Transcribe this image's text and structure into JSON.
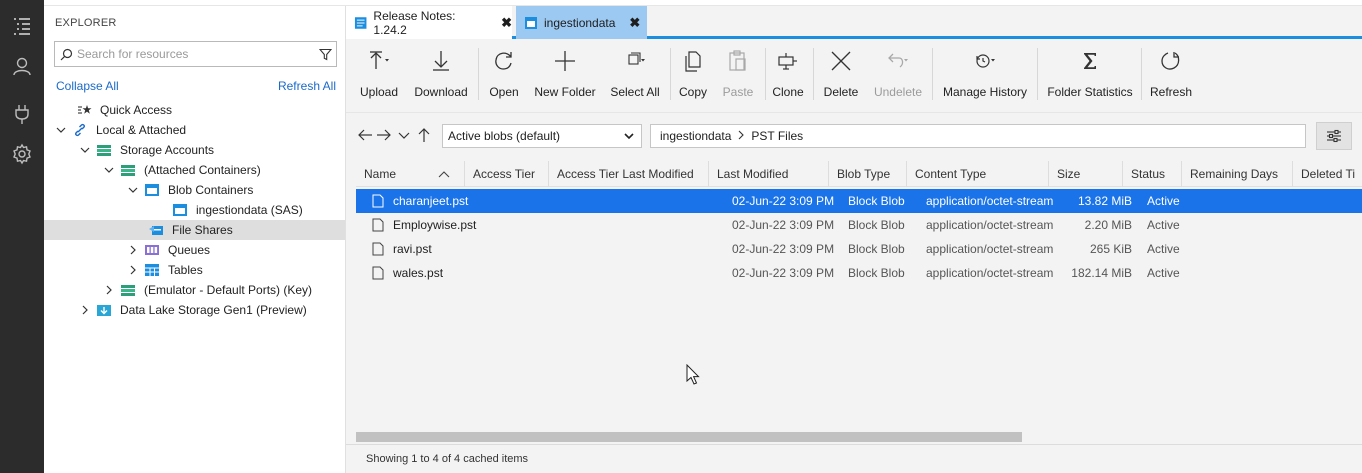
{
  "tabs": [
    {
      "label": "Release Notes: 1.24.2",
      "close": "✖"
    },
    {
      "label": "ingestiondata",
      "close": "✖"
    }
  ],
  "explorer": {
    "title": "EXPLORER",
    "search_placeholder": "Search for resources",
    "collapse_all": "Collapse All",
    "refresh_all": "Refresh All",
    "tree": [
      {
        "label": "Quick Access"
      },
      {
        "label": "Local & Attached"
      },
      {
        "label": "Storage Accounts"
      },
      {
        "label": "(Attached Containers)"
      },
      {
        "label": "Blob Containers"
      },
      {
        "label": "ingestiondata (SAS)"
      },
      {
        "label": "File Shares"
      },
      {
        "label": "Queues"
      },
      {
        "label": "Tables"
      },
      {
        "label": "(Emulator - Default Ports) (Key)"
      },
      {
        "label": "Data Lake Storage Gen1 (Preview)"
      }
    ]
  },
  "toolbar": {
    "upload": "Upload",
    "download": "Download",
    "open": "Open",
    "new_folder": "New Folder",
    "select_all": "Select All",
    "copy": "Copy",
    "paste": "Paste",
    "clone": "Clone",
    "delete": "Delete",
    "undelete": "Undelete",
    "manage_history": "Manage History",
    "folder_statistics": "Folder Statistics",
    "refresh": "Refresh"
  },
  "address": {
    "view_select": "Active blobs (default)",
    "path": [
      "ingestiondata",
      "PST Files"
    ]
  },
  "table": {
    "columns": [
      "Name",
      "Access Tier",
      "Access Tier Last Modified",
      "Last Modified",
      "Blob Type",
      "Content Type",
      "Size",
      "Status",
      "Remaining Days",
      "Deleted Ti"
    ],
    "rows": [
      {
        "name": "charanjeet.pst",
        "last_modified": "02-Jun-22 3:09 PM",
        "blob_type": "Block Blob",
        "content_type": "application/octet-stream",
        "size": "13.82 MiB",
        "status": "Active"
      },
      {
        "name": "Employwise.pst",
        "last_modified": "02-Jun-22 3:09 PM",
        "blob_type": "Block Blob",
        "content_type": "application/octet-stream",
        "size": "2.20 MiB",
        "status": "Active"
      },
      {
        "name": "ravi.pst",
        "last_modified": "02-Jun-22 3:09 PM",
        "blob_type": "Block Blob",
        "content_type": "application/octet-stream",
        "size": "265 KiB",
        "status": "Active"
      },
      {
        "name": "wales.pst",
        "last_modified": "02-Jun-22 3:09 PM",
        "blob_type": "Block Blob",
        "content_type": "application/octet-stream",
        "size": "182.14 MiB",
        "status": "Active"
      }
    ]
  },
  "status_text": "Showing 1 to 4 of 4 cached items",
  "colors": {
    "accent": "#1a73e8",
    "active_tab": "#9cc9f2",
    "activity_bar": "#2c2c2c",
    "link": "#1b6ac9"
  }
}
